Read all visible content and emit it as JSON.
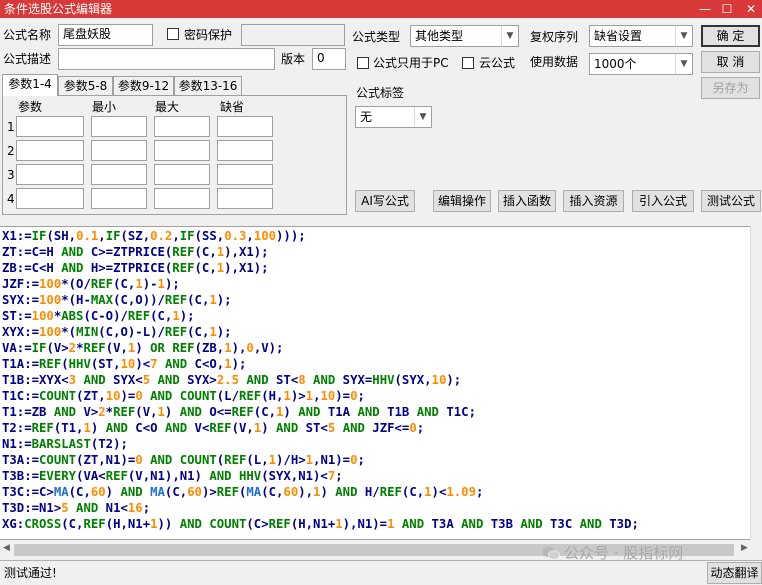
{
  "window": {
    "title": "条件选股公式编辑器",
    "minimize_glyph": "—",
    "maximize_glyph": "☐",
    "close_glyph": "✕"
  },
  "form": {
    "formula_name_label": "公式名称",
    "formula_name_value": "尾盘妖股",
    "password_label": "密码保护",
    "password_checked": false,
    "formula_desc_label": "公式描述",
    "formula_desc_value": "",
    "version_label": "版本",
    "version_value": "0",
    "formula_type_label": "公式类型",
    "formula_type_value": "其他类型",
    "pc_only_label": "公式只用于PC",
    "pc_only_checked": false,
    "cloud_label": "云公式",
    "cloud_checked": false,
    "fq_label": "复权序列",
    "fq_value": "缺省设置",
    "data_label": "使用数据",
    "data_value": "1000个",
    "tag_label": "公式标签",
    "tag_value": "无"
  },
  "buttons": {
    "ok": "确  定",
    "cancel": "取  消",
    "save_as": "另存为",
    "ai_write": "AI写公式",
    "edit_ops": "编辑操作",
    "insert_func": "插入函数",
    "insert_resource": "插入资源",
    "import_formula": "引入公式",
    "test_formula": "测试公式",
    "translate": "动态翻译"
  },
  "param_tabs": [
    "参数1-4",
    "参数5-8",
    "参数9-12",
    "参数13-16"
  ],
  "param_headers": [
    "参数",
    "最小",
    "最大",
    "缺省"
  ],
  "param_rows": [
    "1",
    "2",
    "3",
    "4"
  ],
  "colors": {
    "title_bar": "#d83a3a",
    "code_default": "#00008b",
    "code_function": "#008000",
    "code_number": "#ff8c00",
    "code_keyword": "#008000",
    "code_draw_function": "#1f6fd1"
  },
  "code_lines": [
    [
      [
        "X1:=",
        "t"
      ],
      [
        "IF",
        "f"
      ],
      [
        "(SH,",
        "t"
      ],
      [
        "0.1",
        "n"
      ],
      [
        ",",
        "t"
      ],
      [
        "IF",
        "f"
      ],
      [
        "(SZ,",
        "t"
      ],
      [
        "0.2",
        "n"
      ],
      [
        ",",
        "t"
      ],
      [
        "IF",
        "f"
      ],
      [
        "(SS,",
        "t"
      ],
      [
        "0.3",
        "n"
      ],
      [
        ",",
        "t"
      ],
      [
        "100",
        "n"
      ],
      [
        ")));",
        "t"
      ]
    ],
    [
      [
        "ZT:=C=H ",
        "t"
      ],
      [
        "AND",
        "k"
      ],
      [
        " C>=ZTPRICE(",
        "t"
      ],
      [
        "REF",
        "f"
      ],
      [
        "(C,",
        "t"
      ],
      [
        "1",
        "n"
      ],
      [
        "),X1);",
        "t"
      ]
    ],
    [
      [
        "ZB:=C<H ",
        "t"
      ],
      [
        "AND",
        "k"
      ],
      [
        " H>=ZTPRICE(",
        "t"
      ],
      [
        "REF",
        "f"
      ],
      [
        "(C,",
        "t"
      ],
      [
        "1",
        "n"
      ],
      [
        "),X1);",
        "t"
      ]
    ],
    [
      [
        "JZF:=",
        "t"
      ],
      [
        "100",
        "n"
      ],
      [
        "*(O/",
        "t"
      ],
      [
        "REF",
        "f"
      ],
      [
        "(C,",
        "t"
      ],
      [
        "1",
        "n"
      ],
      [
        ")-",
        "t"
      ],
      [
        "1",
        "n"
      ],
      [
        ");",
        "t"
      ]
    ],
    [
      [
        "SYX:=",
        "t"
      ],
      [
        "100",
        "n"
      ],
      [
        "*(H-",
        "t"
      ],
      [
        "MAX",
        "f"
      ],
      [
        "(C,O))/",
        "t"
      ],
      [
        "REF",
        "f"
      ],
      [
        "(C,",
        "t"
      ],
      [
        "1",
        "n"
      ],
      [
        ");",
        "t"
      ]
    ],
    [
      [
        "ST:=",
        "t"
      ],
      [
        "100",
        "n"
      ],
      [
        "*",
        "t"
      ],
      [
        "ABS",
        "f"
      ],
      [
        "(C-O)/",
        "t"
      ],
      [
        "REF",
        "f"
      ],
      [
        "(C,",
        "t"
      ],
      [
        "1",
        "n"
      ],
      [
        ");",
        "t"
      ]
    ],
    [
      [
        "XYX:=",
        "t"
      ],
      [
        "100",
        "n"
      ],
      [
        "*(",
        "t"
      ],
      [
        "MIN",
        "f"
      ],
      [
        "(C,O)-L)/",
        "t"
      ],
      [
        "REF",
        "f"
      ],
      [
        "(C,",
        "t"
      ],
      [
        "1",
        "n"
      ],
      [
        ");",
        "t"
      ]
    ],
    [
      [
        "VA:=",
        "t"
      ],
      [
        "IF",
        "f"
      ],
      [
        "(V>",
        "t"
      ],
      [
        "2",
        "n"
      ],
      [
        "*",
        "t"
      ],
      [
        "REF",
        "f"
      ],
      [
        "(V,",
        "t"
      ],
      [
        "1",
        "n"
      ],
      [
        ") ",
        "t"
      ],
      [
        "OR",
        "k"
      ],
      [
        " ",
        "t"
      ],
      [
        "REF",
        "f"
      ],
      [
        "(ZB,",
        "t"
      ],
      [
        "1",
        "n"
      ],
      [
        "),",
        "t"
      ],
      [
        "0",
        "n"
      ],
      [
        ",V);",
        "t"
      ]
    ],
    [
      [
        "T1A:=",
        "t"
      ],
      [
        "REF",
        "f"
      ],
      [
        "(",
        "t"
      ],
      [
        "HHV",
        "f"
      ],
      [
        "(ST,",
        "t"
      ],
      [
        "10",
        "n"
      ],
      [
        ")<",
        "t"
      ],
      [
        "7",
        "n"
      ],
      [
        " ",
        "t"
      ],
      [
        "AND",
        "k"
      ],
      [
        " C<O,",
        "t"
      ],
      [
        "1",
        "n"
      ],
      [
        ");",
        "t"
      ]
    ],
    [
      [
        "T1B:=XYX<",
        "t"
      ],
      [
        "3",
        "n"
      ],
      [
        " ",
        "t"
      ],
      [
        "AND",
        "k"
      ],
      [
        " SYX<",
        "t"
      ],
      [
        "5",
        "n"
      ],
      [
        " ",
        "t"
      ],
      [
        "AND",
        "k"
      ],
      [
        " SYX>",
        "t"
      ],
      [
        "2.5",
        "n"
      ],
      [
        " ",
        "t"
      ],
      [
        "AND",
        "k"
      ],
      [
        " ST<",
        "t"
      ],
      [
        "8",
        "n"
      ],
      [
        " ",
        "t"
      ],
      [
        "AND",
        "k"
      ],
      [
        " SYX=",
        "t"
      ],
      [
        "HHV",
        "f"
      ],
      [
        "(SYX,",
        "t"
      ],
      [
        "10",
        "n"
      ],
      [
        ");",
        "t"
      ]
    ],
    [
      [
        "T1C:=",
        "t"
      ],
      [
        "COUNT",
        "f"
      ],
      [
        "(ZT,",
        "t"
      ],
      [
        "10",
        "n"
      ],
      [
        ")=",
        "t"
      ],
      [
        "0",
        "n"
      ],
      [
        " ",
        "t"
      ],
      [
        "AND",
        "k"
      ],
      [
        " ",
        "t"
      ],
      [
        "COUNT",
        "f"
      ],
      [
        "(L/",
        "t"
      ],
      [
        "REF",
        "f"
      ],
      [
        "(H,",
        "t"
      ],
      [
        "1",
        "n"
      ],
      [
        ")>",
        "t"
      ],
      [
        "1",
        "n"
      ],
      [
        ",",
        "t"
      ],
      [
        "10",
        "n"
      ],
      [
        ")=",
        "t"
      ],
      [
        "0",
        "n"
      ],
      [
        ";",
        "t"
      ]
    ],
    [
      [
        "T1:=ZB ",
        "t"
      ],
      [
        "AND",
        "k"
      ],
      [
        " V>",
        "t"
      ],
      [
        "2",
        "n"
      ],
      [
        "*",
        "t"
      ],
      [
        "REF",
        "f"
      ],
      [
        "(V,",
        "t"
      ],
      [
        "1",
        "n"
      ],
      [
        ") ",
        "t"
      ],
      [
        "AND",
        "k"
      ],
      [
        " O<=",
        "t"
      ],
      [
        "REF",
        "f"
      ],
      [
        "(C,",
        "t"
      ],
      [
        "1",
        "n"
      ],
      [
        ") ",
        "t"
      ],
      [
        "AND",
        "k"
      ],
      [
        " T1A ",
        "t"
      ],
      [
        "AND",
        "k"
      ],
      [
        " T1B ",
        "t"
      ],
      [
        "AND",
        "k"
      ],
      [
        " T1C;",
        "t"
      ]
    ],
    [
      [
        "T2:=",
        "t"
      ],
      [
        "REF",
        "f"
      ],
      [
        "(T1,",
        "t"
      ],
      [
        "1",
        "n"
      ],
      [
        ") ",
        "t"
      ],
      [
        "AND",
        "k"
      ],
      [
        " C<O ",
        "t"
      ],
      [
        "AND",
        "k"
      ],
      [
        " V<",
        "t"
      ],
      [
        "REF",
        "f"
      ],
      [
        "(V,",
        "t"
      ],
      [
        "1",
        "n"
      ],
      [
        ") ",
        "t"
      ],
      [
        "AND",
        "k"
      ],
      [
        " ST<",
        "t"
      ],
      [
        "5",
        "n"
      ],
      [
        " ",
        "t"
      ],
      [
        "AND",
        "k"
      ],
      [
        " JZF<=",
        "t"
      ],
      [
        "0",
        "n"
      ],
      [
        ";",
        "t"
      ]
    ],
    [
      [
        "N1:=",
        "t"
      ],
      [
        "BARSLAST",
        "f"
      ],
      [
        "(T2);",
        "t"
      ]
    ],
    [
      [
        "T3A:=",
        "t"
      ],
      [
        "COUNT",
        "f"
      ],
      [
        "(ZT,N1)=",
        "t"
      ],
      [
        "0",
        "n"
      ],
      [
        " ",
        "t"
      ],
      [
        "AND",
        "k"
      ],
      [
        " ",
        "t"
      ],
      [
        "COUNT",
        "f"
      ],
      [
        "(",
        "t"
      ],
      [
        "REF",
        "f"
      ],
      [
        "(L,",
        "t"
      ],
      [
        "1",
        "n"
      ],
      [
        ")/H>",
        "t"
      ],
      [
        "1",
        "n"
      ],
      [
        ",N1)=",
        "t"
      ],
      [
        "0",
        "n"
      ],
      [
        ";",
        "t"
      ]
    ],
    [
      [
        "T3B:=",
        "t"
      ],
      [
        "EVERY",
        "f"
      ],
      [
        "(VA<",
        "t"
      ],
      [
        "REF",
        "f"
      ],
      [
        "(V,N1),N1) ",
        "t"
      ],
      [
        "AND",
        "k"
      ],
      [
        " ",
        "t"
      ],
      [
        "HHV",
        "f"
      ],
      [
        "(SYX,N1)<",
        "t"
      ],
      [
        "7",
        "n"
      ],
      [
        ";",
        "t"
      ]
    ],
    [
      [
        "T3C:=C>",
        "t"
      ],
      [
        "MA",
        "d"
      ],
      [
        "(C,",
        "t"
      ],
      [
        "60",
        "n"
      ],
      [
        ") ",
        "t"
      ],
      [
        "AND",
        "k"
      ],
      [
        " ",
        "t"
      ],
      [
        "MA",
        "d"
      ],
      [
        "(C,",
        "t"
      ],
      [
        "60",
        "n"
      ],
      [
        ")>",
        "t"
      ],
      [
        "REF",
        "f"
      ],
      [
        "(",
        "t"
      ],
      [
        "MA",
        "d"
      ],
      [
        "(C,",
        "t"
      ],
      [
        "60",
        "n"
      ],
      [
        "),",
        "t"
      ],
      [
        "1",
        "n"
      ],
      [
        ") ",
        "t"
      ],
      [
        "AND",
        "k"
      ],
      [
        " H/",
        "t"
      ],
      [
        "REF",
        "f"
      ],
      [
        "(C,",
        "t"
      ],
      [
        "1",
        "n"
      ],
      [
        ")<",
        "t"
      ],
      [
        "1.09",
        "n"
      ],
      [
        ";",
        "t"
      ]
    ],
    [
      [
        "T3D:=N1>",
        "t"
      ],
      [
        "5",
        "n"
      ],
      [
        " ",
        "t"
      ],
      [
        "AND",
        "k"
      ],
      [
        " N1<",
        "t"
      ],
      [
        "16",
        "n"
      ],
      [
        ";",
        "t"
      ]
    ],
    [
      [
        "XG:",
        "t"
      ],
      [
        "CROSS",
        "f"
      ],
      [
        "(C,",
        "t"
      ],
      [
        "REF",
        "f"
      ],
      [
        "(H,N1+",
        "t"
      ],
      [
        "1",
        "n"
      ],
      [
        ")) ",
        "t"
      ],
      [
        "AND",
        "k"
      ],
      [
        " ",
        "t"
      ],
      [
        "COUNT",
        "f"
      ],
      [
        "(C>",
        "t"
      ],
      [
        "REF",
        "f"
      ],
      [
        "(H,N1+",
        "t"
      ],
      [
        "1",
        "n"
      ],
      [
        "),N1)=",
        "t"
      ],
      [
        "1",
        "n"
      ],
      [
        " ",
        "t"
      ],
      [
        "AND",
        "k"
      ],
      [
        " T3A ",
        "t"
      ],
      [
        "AND",
        "k"
      ],
      [
        " T3B ",
        "t"
      ],
      [
        "AND",
        "k"
      ],
      [
        " T3C ",
        "t"
      ],
      [
        "AND",
        "k"
      ],
      [
        " T3D;",
        "t"
      ]
    ]
  ],
  "status": {
    "message": "测试通过!"
  },
  "watermark": {
    "text": "公众号 · 股指标网"
  }
}
